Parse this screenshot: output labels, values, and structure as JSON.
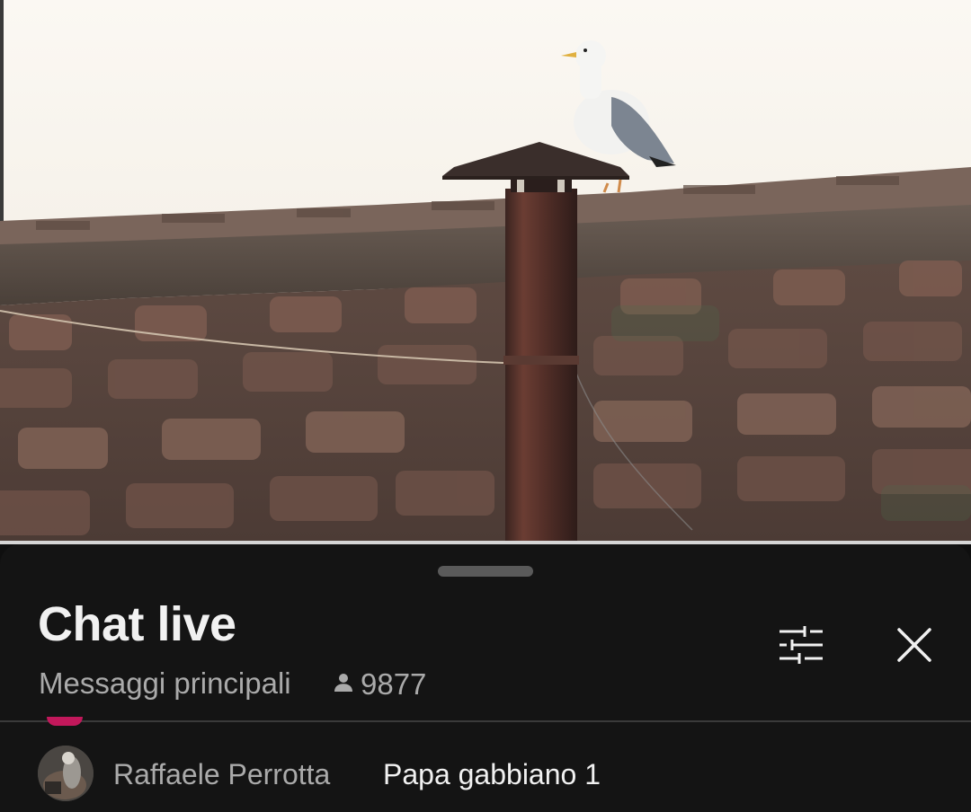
{
  "video": {
    "scene": "rooftop-chimney-seagull"
  },
  "chat": {
    "title": "Chat live",
    "mode_label": "Messaggi principali",
    "viewer_count": "9877",
    "icons": {
      "viewers": "person-icon",
      "filter": "filter-sliders-icon",
      "close": "close-icon"
    },
    "messages": [
      {
        "author": "Raffaele Perrotta",
        "text": "Papa gabbiano 1"
      }
    ]
  },
  "colors": {
    "sheet_background": "#141414",
    "title_text": "#f1f1f1",
    "secondary_text": "#aaaaaa"
  }
}
